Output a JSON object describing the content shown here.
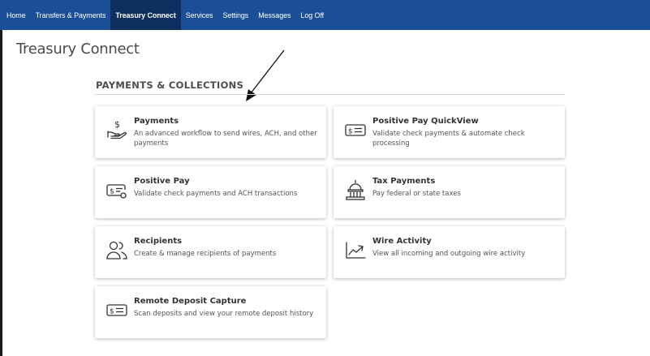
{
  "nav": {
    "items": [
      {
        "label": "Home"
      },
      {
        "label": "Transfers & Payments"
      },
      {
        "label": "Treasury Connect"
      },
      {
        "label": "Services"
      },
      {
        "label": "Settings"
      },
      {
        "label": "Messages"
      },
      {
        "label": "Log Off"
      }
    ],
    "active": "Treasury Connect"
  },
  "page": {
    "title": "Treasury Connect"
  },
  "section": {
    "heading": "PAYMENTS & COLLECTIONS"
  },
  "cards": {
    "payments": {
      "title": "Payments",
      "description": "An advanced workflow to send wires, ACH, and other payments",
      "icon": "hand-dollar-icon"
    },
    "quickview": {
      "title": "Positive Pay QuickView",
      "description": "Validate check payments & automate check processing",
      "icon": "check-dollar-icon"
    },
    "positivepay": {
      "title": "Positive Pay",
      "description": "Validate check payments and ACH transactions",
      "icon": "check-search-icon"
    },
    "tax": {
      "title": "Tax Payments",
      "description": "Pay federal or state taxes",
      "icon": "capitol-building-icon"
    },
    "recipients": {
      "title": "Recipients",
      "description": "Create & manage recipients of payments",
      "icon": "users-icon"
    },
    "wire": {
      "title": "Wire Activity",
      "description": "View all incoming and outgoing wire activity",
      "icon": "trend-chart-icon"
    },
    "rdc": {
      "title": "Remote Deposit Capture",
      "description": "Scan deposits and view your remote deposit history",
      "icon": "check-dollar-icon"
    }
  },
  "colors": {
    "nav_bg": "#1a4f98",
    "nav_active": "#0d2e5e",
    "text": "#333333"
  }
}
